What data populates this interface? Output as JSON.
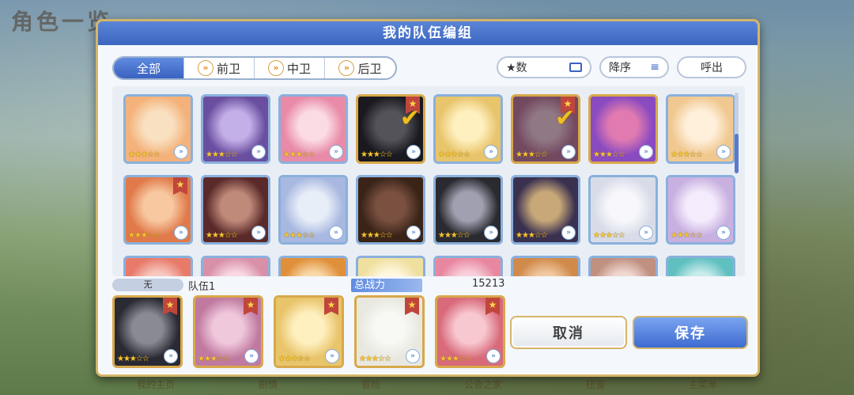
{
  "background": {
    "title": "角色一览",
    "nav": [
      "我的主页",
      "剧情",
      "冒险",
      "公会之家",
      "扭蛋",
      "主菜单"
    ]
  },
  "modal": {
    "title": "我的队伍编组"
  },
  "tabs": [
    {
      "label": "全部",
      "active": true
    },
    {
      "label": "前卫",
      "active": false
    },
    {
      "label": "中卫",
      "active": false
    },
    {
      "label": "后卫",
      "active": false
    }
  ],
  "sort": {
    "field": "★数",
    "order": "降序",
    "call": "呼出"
  },
  "roster": [
    {
      "colors": [
        "#f4b27a",
        "#f9e0c0"
      ],
      "stars": 3,
      "flag": false,
      "check": false,
      "gold": false
    },
    {
      "colors": [
        "#6a4fa0",
        "#c4b0e8"
      ],
      "stars": 3,
      "flag": false,
      "check": false,
      "gold": false
    },
    {
      "colors": [
        "#e88aa8",
        "#fbdbe4"
      ],
      "stars": 3,
      "flag": false,
      "check": false,
      "gold": false
    },
    {
      "colors": [
        "#2a2a34",
        "#8a8a94"
      ],
      "stars": 3,
      "flag": true,
      "check": true,
      "gold": true
    },
    {
      "colors": [
        "#e8c46a",
        "#fff0c0"
      ],
      "stars": 3,
      "flag": false,
      "check": false,
      "gold": false
    },
    {
      "colors": [
        "#c07aa0",
        "#f0c8dc"
      ],
      "stars": 3,
      "flag": true,
      "check": true,
      "gold": true
    },
    {
      "colors": [
        "#8a4ac0",
        "#e07ab0"
      ],
      "stars": 3,
      "flag": false,
      "check": false,
      "gold": true
    },
    {
      "colors": [
        "#f0c890",
        "#fff0dc"
      ],
      "stars": 3,
      "flag": false,
      "check": false,
      "gold": false
    },
    {
      "colors": [
        "#e07a4a",
        "#f8c8a0"
      ],
      "stars": 3,
      "flag": true,
      "check": false,
      "gold": false
    },
    {
      "colors": [
        "#5a2a2a",
        "#c08a7a"
      ],
      "stars": 3,
      "flag": false,
      "check": false,
      "gold": false
    },
    {
      "colors": [
        "#a8b8e0",
        "#e8eef8"
      ],
      "stars": 3,
      "flag": false,
      "check": false,
      "gold": false
    },
    {
      "colors": [
        "#3a2418",
        "#7a5040"
      ],
      "stars": 3,
      "flag": false,
      "check": false,
      "gold": false
    },
    {
      "colors": [
        "#2a2a30",
        "#a0a0b0"
      ],
      "stars": 3,
      "flag": false,
      "check": false,
      "gold": false
    },
    {
      "colors": [
        "#3a3050",
        "#c8a878"
      ],
      "stars": 3,
      "flag": false,
      "check": false,
      "gold": false
    },
    {
      "colors": [
        "#d8dce8",
        "#f8f8fc"
      ],
      "stars": 3,
      "flag": false,
      "check": false,
      "gold": false
    },
    {
      "colors": [
        "#c8b0e0",
        "#f4ecfc"
      ],
      "stars": 3,
      "flag": false,
      "check": false,
      "gold": false
    },
    {
      "colors": [
        "#e87a6a",
        "#f8c8c0"
      ],
      "stars": 3,
      "flag": false,
      "check": false,
      "gold": false
    },
    {
      "colors": [
        "#d890a8",
        "#f8d8e4"
      ],
      "stars": 3,
      "flag": false,
      "check": false,
      "gold": false
    },
    {
      "colors": [
        "#e0903a",
        "#f8d8a8"
      ],
      "stars": 3,
      "flag": false,
      "check": false,
      "gold": false
    },
    {
      "colors": [
        "#f0e0a0",
        "#fff8e0"
      ],
      "stars": 3,
      "flag": false,
      "check": false,
      "gold": false
    },
    {
      "colors": [
        "#e888a0",
        "#f8d0dc"
      ],
      "stars": 3,
      "flag": false,
      "check": false,
      "gold": false
    },
    {
      "colors": [
        "#d08a4a",
        "#f0c8a0"
      ],
      "stars": 3,
      "flag": false,
      "check": false,
      "gold": false
    },
    {
      "colors": [
        "#c09080",
        "#f0d8d0"
      ],
      "stars": 3,
      "flag": false,
      "check": false,
      "gold": false
    },
    {
      "colors": [
        "#60c0c0",
        "#c8ecec"
      ],
      "stars": 3,
      "flag": false,
      "check": false,
      "gold": false
    }
  ],
  "team_info": {
    "none_label": "无",
    "name": "队伍1",
    "power_label": "总战力",
    "power_value": "15213"
  },
  "team": [
    {
      "colors": [
        "#2a2a34",
        "#8a8a94"
      ],
      "stars": 3
    },
    {
      "colors": [
        "#c07aa0",
        "#f0c8dc"
      ],
      "stars": 3
    },
    {
      "colors": [
        "#e8c46a",
        "#fff0c0"
      ],
      "stars": 3
    },
    {
      "colors": [
        "#e8e8e0",
        "#f8f8f4"
      ],
      "stars": 3
    },
    {
      "colors": [
        "#d86a7a",
        "#f8c8d0"
      ],
      "stars": 3
    }
  ],
  "buttons": {
    "cancel": "取消",
    "save": "保存"
  }
}
